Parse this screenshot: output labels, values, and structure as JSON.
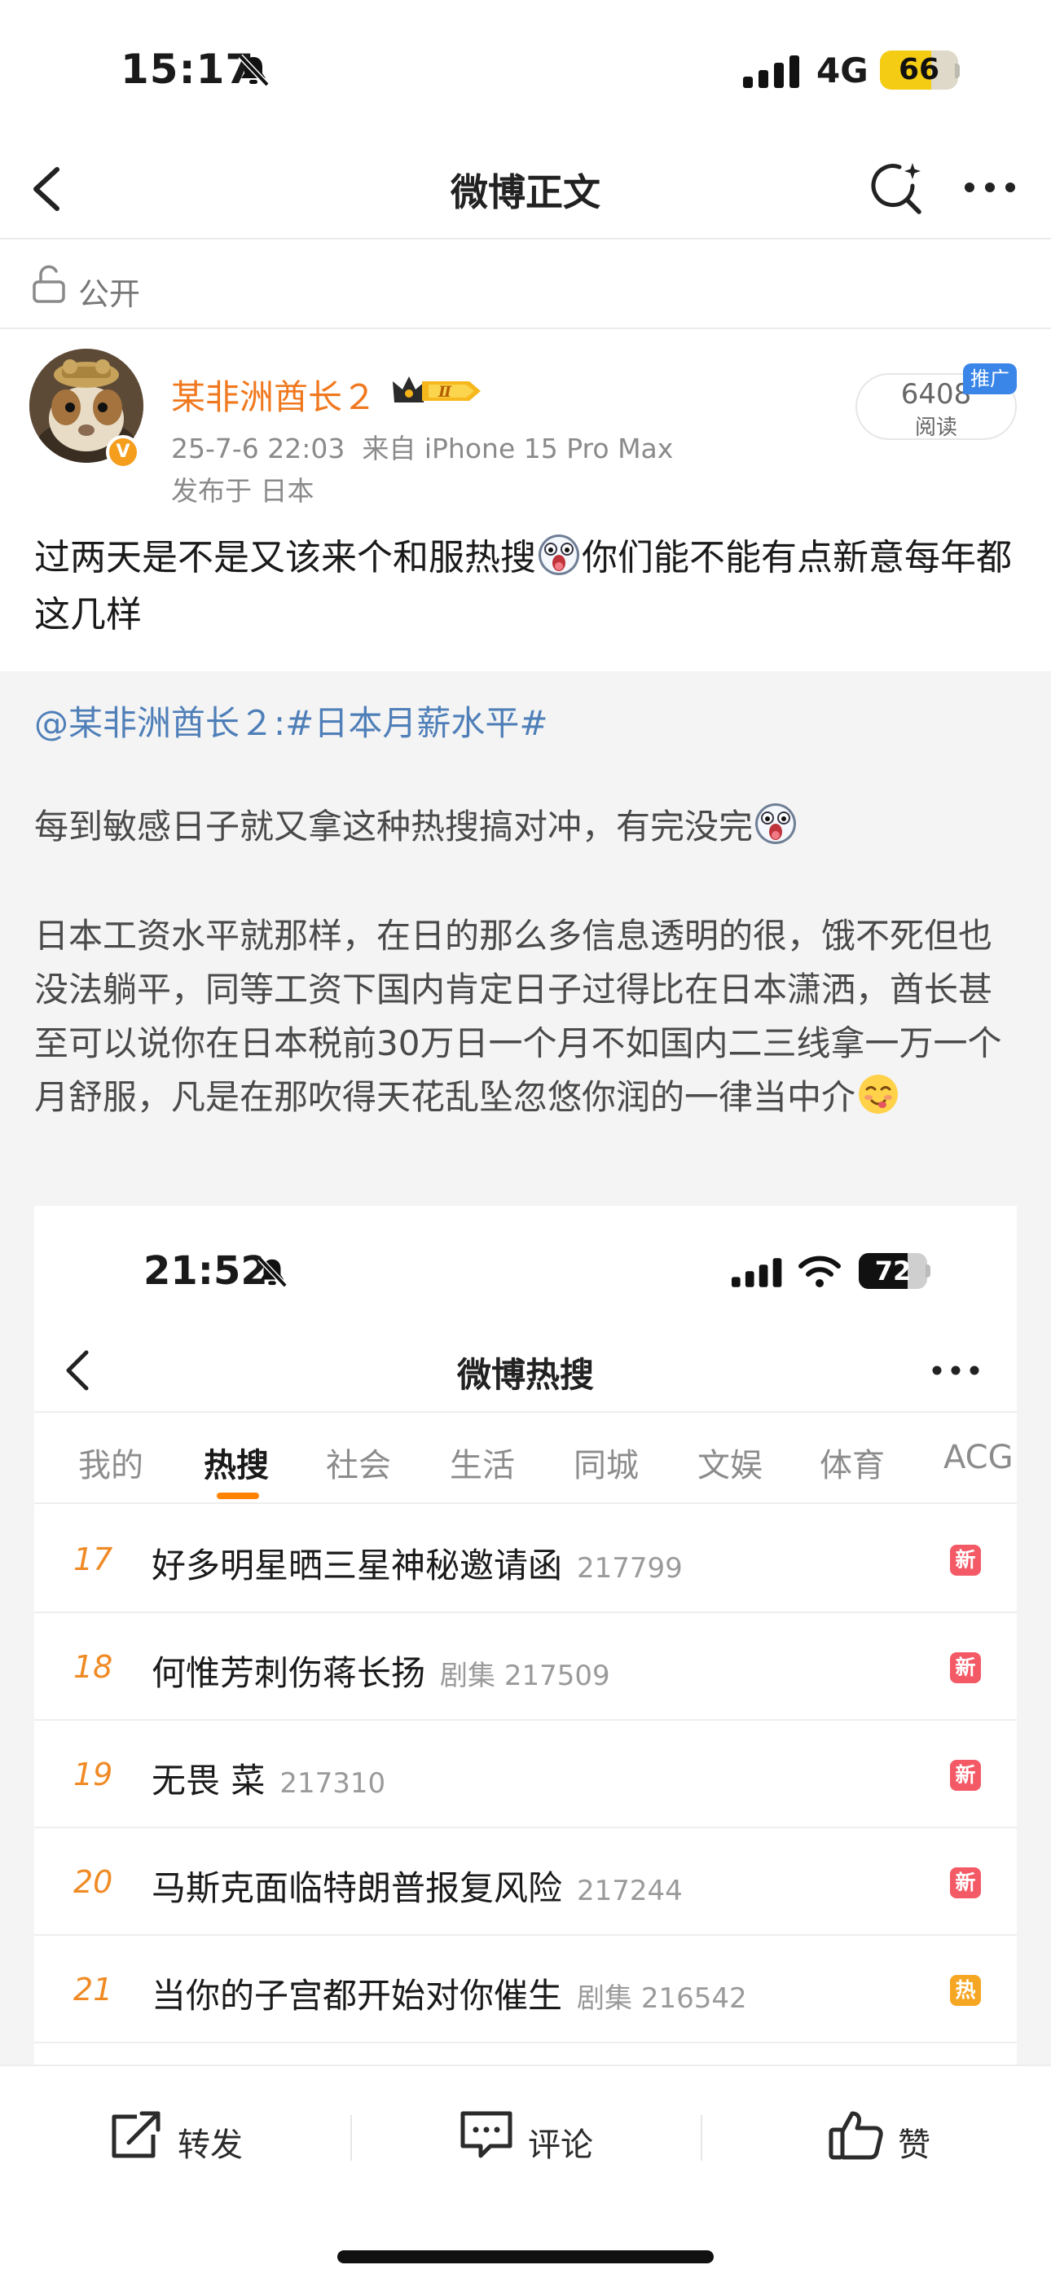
{
  "status_bar": {
    "time": "15:17",
    "network": "4G",
    "battery": "66",
    "battery_level": 0.66
  },
  "nav": {
    "title": "微博正文",
    "back_icon": "chevron-left-icon",
    "search_icon": "search-sparkle-icon",
    "more_icon": "more-dots-icon"
  },
  "visibility": {
    "label": "公开",
    "icon": "unlock-icon"
  },
  "author": {
    "name": "某非洲酋长２",
    "vip_level": "Ⅱ",
    "badge_icon": "verified-v-icon",
    "time": "25-7-6 22:03",
    "source": "来自 iPhone 15 Pro Max",
    "location": "发布于 日本"
  },
  "read_count": {
    "count": "6408",
    "label": "阅读",
    "promo": "推广"
  },
  "post": {
    "text_a": "过两天是不是又该来个和服热搜",
    "text_b": "你们能不能有点新意每年都这几样"
  },
  "repost": {
    "mention": "@某非洲酋长２:#日本月薪水平#",
    "p1": "每到敏感日子就又拿这种热搜搞对冲，有完没完",
    "p2": "日本工资水平就那样，在日的那么多信息透明的很，饿不死但也没法躺平，同等工资下国内肯定日子过得比在日本潇洒，酋长甚至可以说你在日本税前30万日一个月不如国内二三线拿一万一个月舒服，凡是在那吹得天花乱坠忽悠你润的一律当中介"
  },
  "screenshot": {
    "time": "21:52",
    "battery": "72",
    "battery_level": 0.72,
    "title": "微博热搜",
    "tabs": [
      "我的",
      "热搜",
      "社会",
      "生活",
      "同城",
      "文娱",
      "体育",
      "ACG"
    ],
    "active_tab": "热搜",
    "items": [
      {
        "rank": "17",
        "title": "好多明星晒三星神秘邀请函",
        "meta": "217799",
        "badge": "新",
        "badge_color": "#f35a66"
      },
      {
        "rank": "18",
        "title": "何惟芳刺伤蒋长扬",
        "meta": "剧集 217509",
        "badge": "新",
        "badge_color": "#f35a66"
      },
      {
        "rank": "19",
        "title": "无畏 菜",
        "meta": "217310",
        "badge": "新",
        "badge_color": "#f35a66"
      },
      {
        "rank": "20",
        "title": "马斯克面临特朗普报复风险",
        "meta": "217244",
        "badge": "新",
        "badge_color": "#f35a66"
      },
      {
        "rank": "21",
        "title": "当你的子宫都开始对你催生",
        "meta": "剧集 216542",
        "badge": "热",
        "badge_color": "#f5a623"
      }
    ]
  },
  "actions": {
    "repost": {
      "label": "转发",
      "icon": "share-icon"
    },
    "comment": {
      "label": "评论",
      "icon": "comment-icon"
    },
    "like": {
      "label": "赞",
      "icon": "thumbs-up-icon"
    }
  },
  "colors": {
    "author_name": "#f0781e",
    "link": "#4f7fb8",
    "rank": "#f08a24",
    "tab_indicator": "#ff8200",
    "battery": "#f5cc14"
  }
}
